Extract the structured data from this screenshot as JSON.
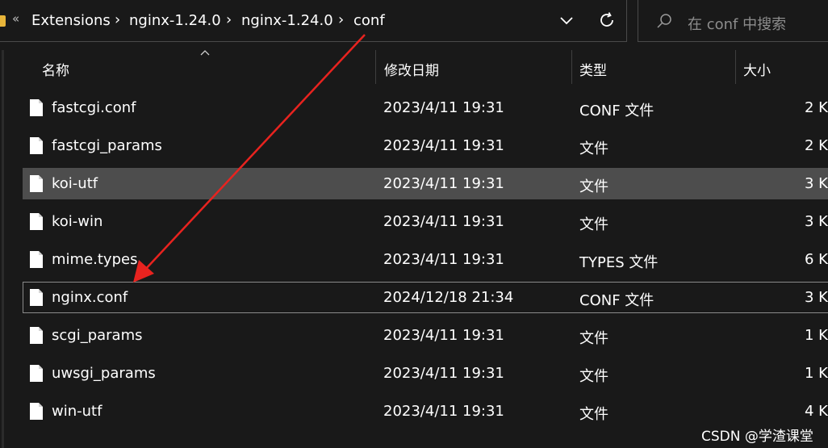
{
  "address_bar": {
    "overflow": "«",
    "crumbs": [
      "Extensions",
      "nginx-1.24.0",
      "nginx-1.24.0",
      "conf"
    ],
    "separator": "›"
  },
  "search": {
    "placeholder": "在 conf 中搜索"
  },
  "columns": {
    "name": "名称",
    "modified": "修改日期",
    "type": "类型",
    "size": "大小"
  },
  "files": [
    {
      "name": "fastcgi.conf",
      "modified": "2023/4/11 19:31",
      "type": "CONF 文件",
      "size": "2 K"
    },
    {
      "name": "fastcgi_params",
      "modified": "2023/4/11 19:31",
      "type": "文件",
      "size": "2 K"
    },
    {
      "name": "koi-utf",
      "modified": "2023/4/11 19:31",
      "type": "文件",
      "size": "3 K"
    },
    {
      "name": "koi-win",
      "modified": "2023/4/11 19:31",
      "type": "文件",
      "size": "3 K"
    },
    {
      "name": "mime.types",
      "modified": "2023/4/11 19:31",
      "type": "TYPES 文件",
      "size": "6 K"
    },
    {
      "name": "nginx.conf",
      "modified": "2024/12/18 21:34",
      "type": "CONF 文件",
      "size": "3 K"
    },
    {
      "name": "scgi_params",
      "modified": "2023/4/11 19:31",
      "type": "文件",
      "size": "1 K"
    },
    {
      "name": "uwsgi_params",
      "modified": "2023/4/11 19:31",
      "type": "文件",
      "size": "1 K"
    },
    {
      "name": "win-utf",
      "modified": "2023/4/11 19:31",
      "type": "文件",
      "size": "4 K"
    }
  ],
  "hovered_row": "koi-utf",
  "focused_row": "nginx.conf",
  "watermark": "CSDN @学渣课堂",
  "colors": {
    "background": "#191919",
    "hover_row": "#4d4d4d",
    "annotation_arrow": "#e8231f",
    "folder": "#e8b53a"
  }
}
